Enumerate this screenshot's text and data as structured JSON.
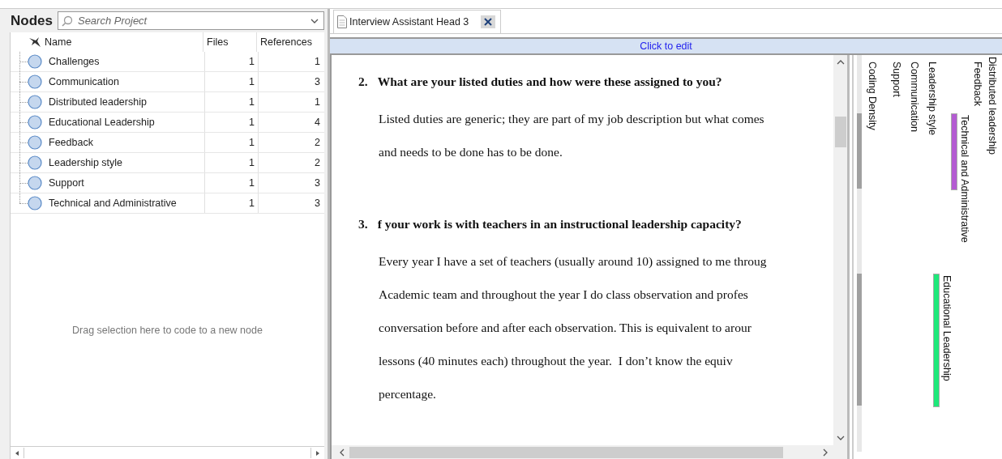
{
  "nodes_panel": {
    "title": "Nodes",
    "search": {
      "placeholder": "Search Project"
    },
    "columns": [
      "Name",
      "Files",
      "References"
    ],
    "rows": [
      {
        "name": "Challenges",
        "files": "1",
        "references": "1"
      },
      {
        "name": "Communication",
        "files": "1",
        "references": "3"
      },
      {
        "name": "Distributed leadership",
        "files": "1",
        "references": "1"
      },
      {
        "name": "Educational Leadership",
        "files": "1",
        "references": "4"
      },
      {
        "name": "Feedback",
        "files": "1",
        "references": "2"
      },
      {
        "name": "Leadership style",
        "files": "1",
        "references": "2"
      },
      {
        "name": "Support",
        "files": "1",
        "references": "3"
      },
      {
        "name": "Technical and Administrative",
        "files": "1",
        "references": "3"
      }
    ],
    "drop_hint": "Drag selection here to code to a new node"
  },
  "tabs": [
    {
      "label": "Interview Assistant Head 3",
      "selected": true
    }
  ],
  "edit_bar": "Click to edit",
  "document": [
    {
      "kind": "question",
      "number": "2.",
      "text": "What are your listed duties and how were these assigned to you?"
    },
    {
      "kind": "answer",
      "lines": [
        "Listed duties are generic; they are part of my job description but what comes",
        "and needs to be done has to be done."
      ]
    },
    {
      "kind": "question",
      "number": "3.",
      "text": "f your work is with teachers in an instructional leadership capacity?"
    },
    {
      "kind": "answer",
      "lines": [
        "Every year I have a set of teachers (usually around 10) assigned to me throug",
        "Academic team and throughout the year I do class observation and profes",
        "conversation before and after each observation. This is equivalent to arour",
        "lessons (40 minutes each) throughout the year.  I don’t know the equiv",
        "percentage."
      ]
    }
  ],
  "stripes": [
    {
      "name": "Coding Density"
    },
    {
      "name": "Support"
    },
    {
      "name": "Communication"
    },
    {
      "name": "Leadership style"
    },
    {
      "name": "Educational Leadership",
      "color": "#1ee87a"
    },
    {
      "name": "Technical and Administrative",
      "color": "#b45cd2"
    },
    {
      "name": "Feedback"
    },
    {
      "name": "Distributed leadership"
    }
  ]
}
